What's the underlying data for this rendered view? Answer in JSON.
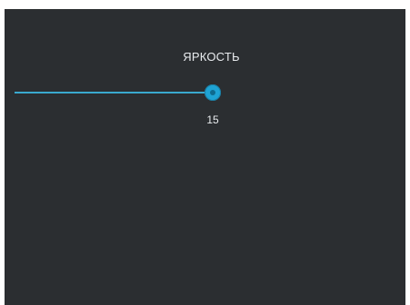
{
  "brightness": {
    "title": "ЯРКОСТЬ",
    "value_text": "15",
    "fraction": 0.52
  },
  "colors": {
    "background": "#2b2e31",
    "accent": "#1ea3d4",
    "text": "#e9ecef"
  }
}
